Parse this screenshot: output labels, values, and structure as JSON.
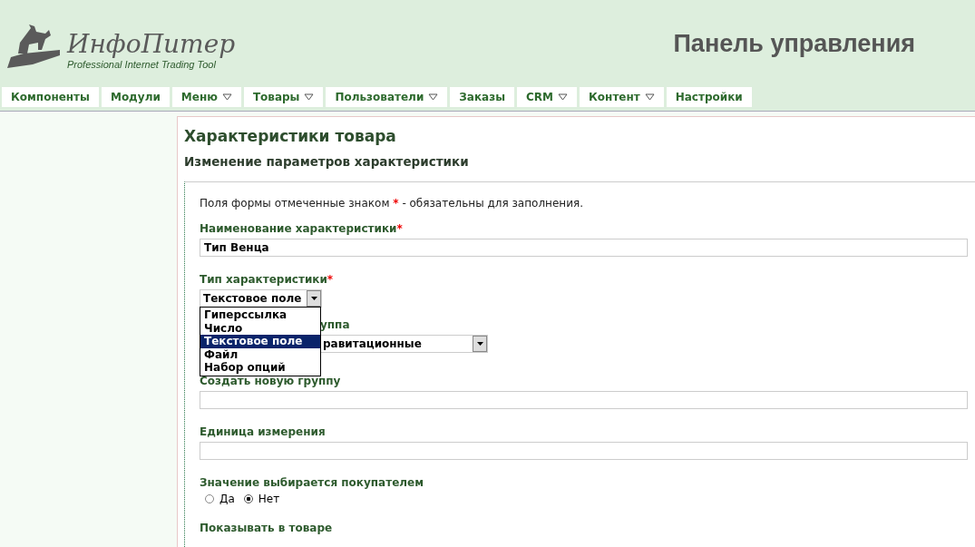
{
  "header": {
    "logo_name": "ИнфоПитер",
    "logo_tagline": "Professional Internet Trading Tool",
    "title": "Панель управления"
  },
  "nav": [
    {
      "label": "Компоненты",
      "dropdown": false
    },
    {
      "label": "Модули",
      "dropdown": false
    },
    {
      "label": "Меню",
      "dropdown": true
    },
    {
      "label": "Товары",
      "dropdown": true
    },
    {
      "label": "Пользователи",
      "dropdown": true
    },
    {
      "label": "Заказы",
      "dropdown": false
    },
    {
      "label": "CRM",
      "dropdown": true
    },
    {
      "label": "Контент",
      "dropdown": true
    },
    {
      "label": "Настройки",
      "dropdown": false
    }
  ],
  "page": {
    "title": "Характеристики товара",
    "subtitle": "Изменение параметров характеристики"
  },
  "form": {
    "note_before": "Поля формы отмеченные знаком",
    "required_mark": "*",
    "note_after": "- обязательны для заполнения.",
    "name": {
      "label": "Наименование характеристики",
      "required": true,
      "value": "Тип Венца"
    },
    "type": {
      "label": "Тип характеристики",
      "required": true,
      "value": "Текстовое поле",
      "options": [
        {
          "label": "Гиперссылка",
          "selected": false
        },
        {
          "label": "Число",
          "selected": false
        },
        {
          "label": "Текстовое поле",
          "selected": true
        },
        {
          "label": "Файл",
          "selected": false
        },
        {
          "label": "Набор опций",
          "selected": false
        }
      ]
    },
    "group": {
      "label": "уппа",
      "value": "равитационные"
    },
    "new_group": {
      "label": "Создать новую группу"
    },
    "unit": {
      "label": "Единица измерения"
    },
    "buyer_choice": {
      "label": "Значение выбирается покупателем",
      "options": [
        {
          "label": "Да",
          "selected": false
        },
        {
          "label": "Нет",
          "selected": true
        }
      ]
    },
    "show_in_product": {
      "label": "Показывать в товаре"
    }
  }
}
